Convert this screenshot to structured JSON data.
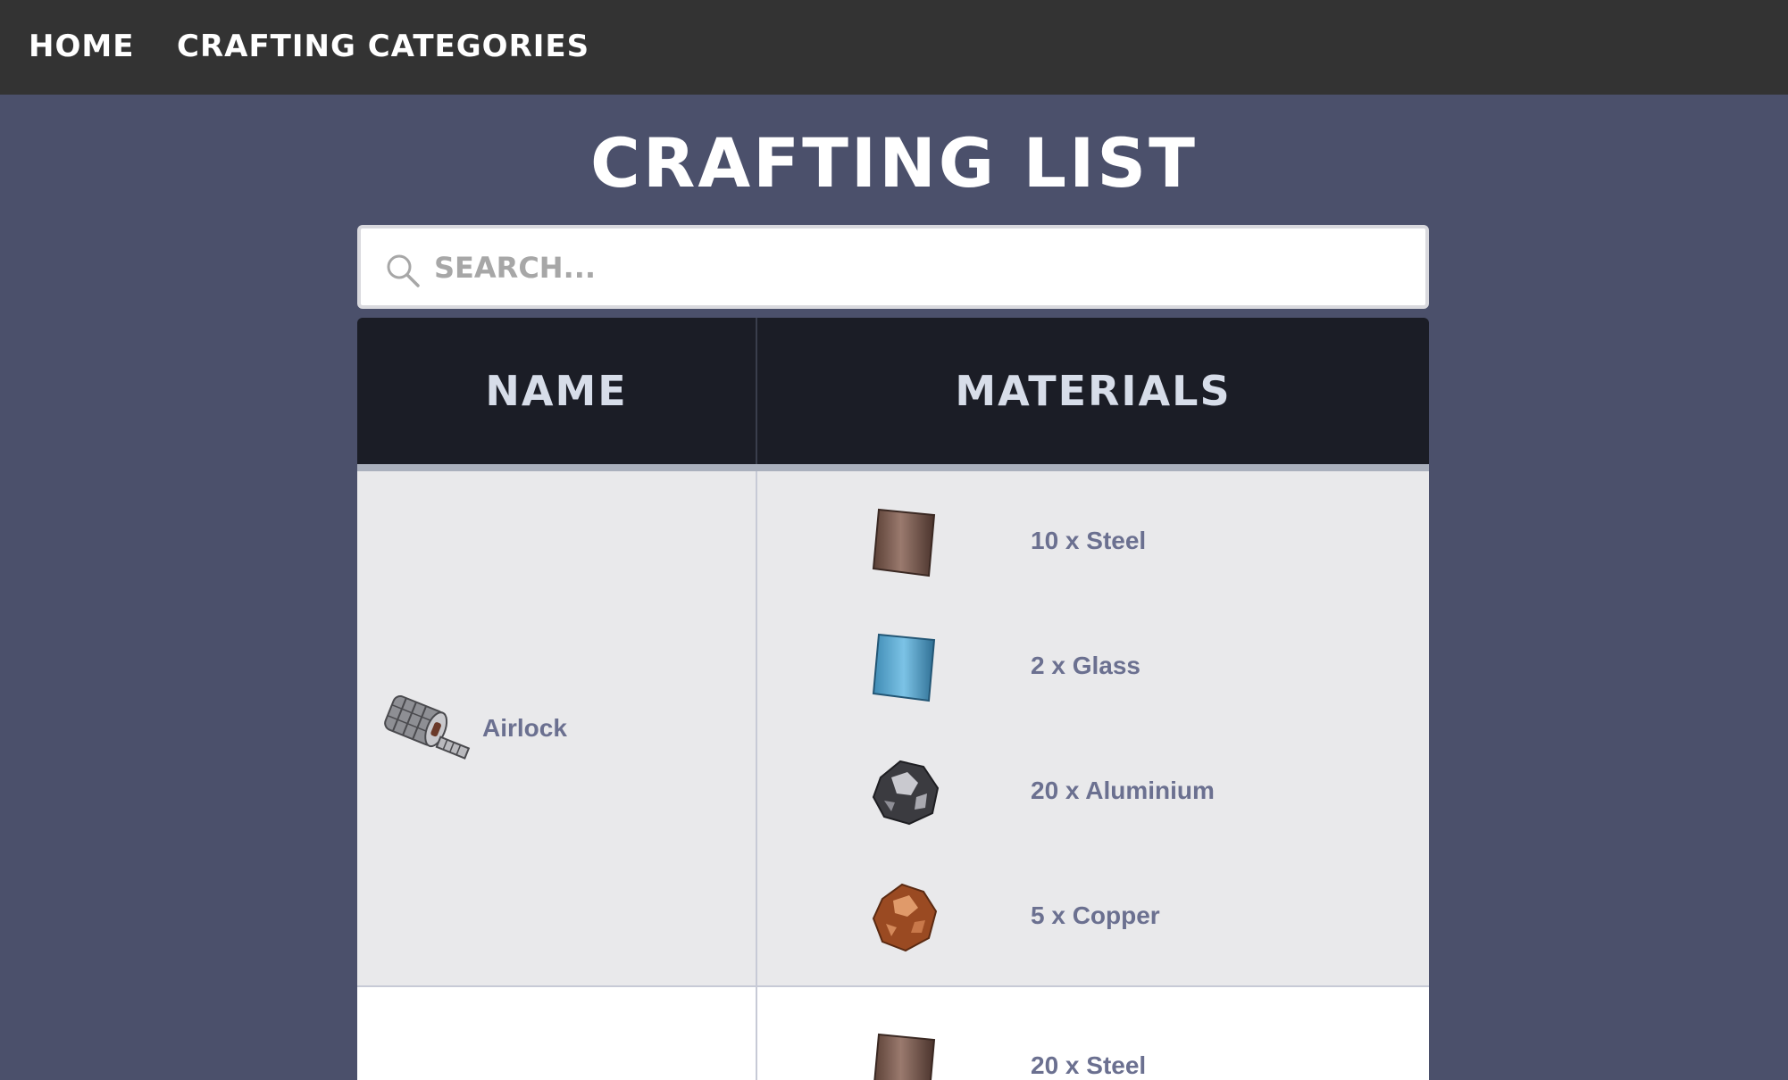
{
  "nav": {
    "home": "Home",
    "categories": "Crafting Categories"
  },
  "page": {
    "title": "Crafting List"
  },
  "search": {
    "placeholder": "SEARCH..."
  },
  "table": {
    "headers": {
      "name": "Name",
      "materials": "Materials"
    },
    "rows": [
      {
        "name": "Airlock",
        "icon": "airlock-icon",
        "materials": [
          {
            "label": "10 x Steel",
            "icon": "steel-icon"
          },
          {
            "label": "2 x Glass",
            "icon": "glass-icon"
          },
          {
            "label": "20 x Aluminium",
            "icon": "aluminium-icon"
          },
          {
            "label": "5 x Copper",
            "icon": "copper-icon"
          }
        ]
      },
      {
        "name": "",
        "materials": [
          {
            "label": "20 x Steel",
            "icon": "steel-icon"
          }
        ]
      }
    ]
  },
  "colors": {
    "background": "#4b506b",
    "topbar": "#333333",
    "table_header": "#1b1d26",
    "row_alt": "#e9e9eb",
    "text_item": "#6b7090"
  }
}
